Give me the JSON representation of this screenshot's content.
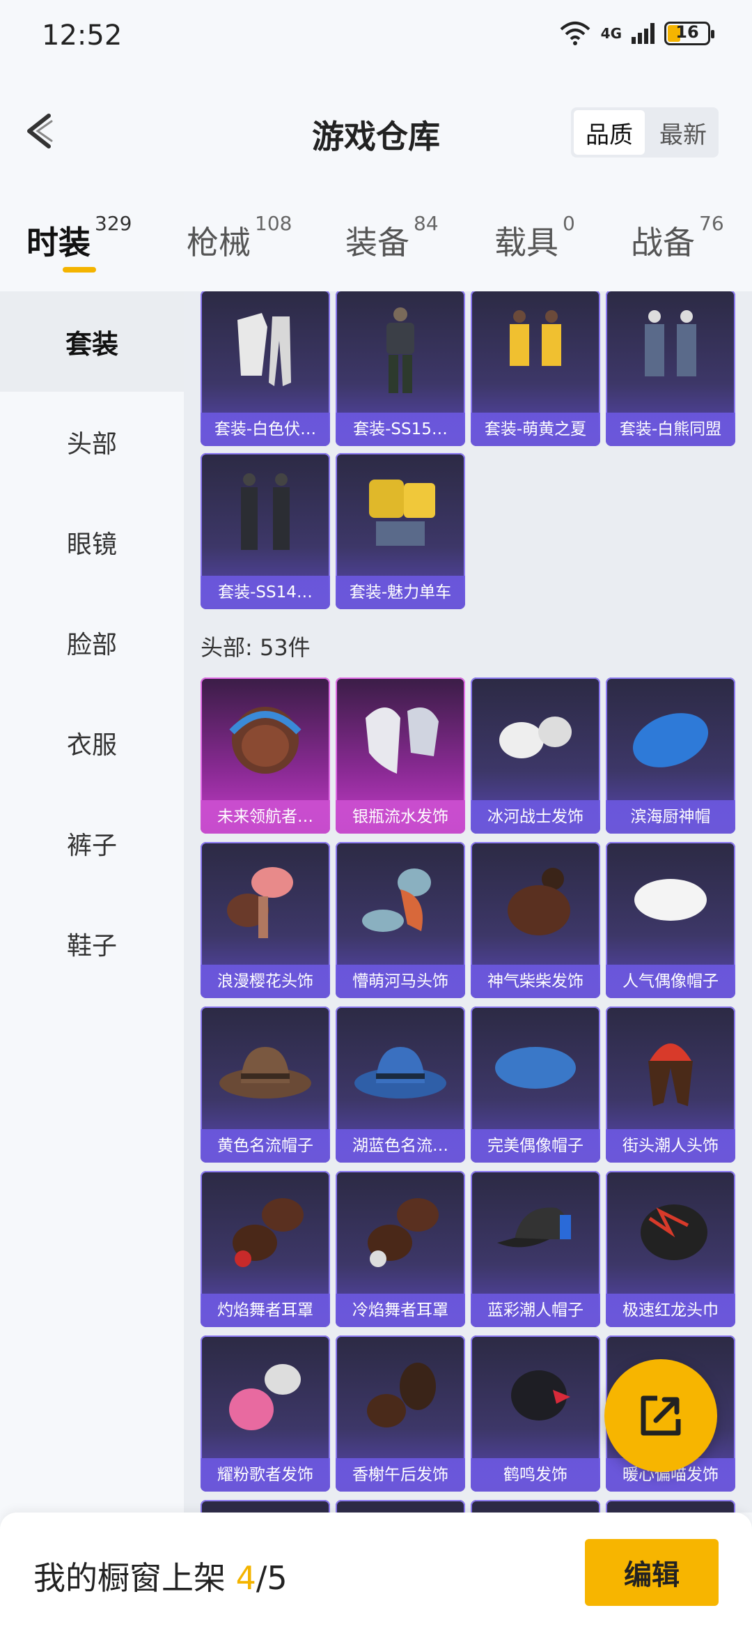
{
  "status_bar": {
    "time": "12:52",
    "network": "4G",
    "battery": "16"
  },
  "header": {
    "title": "游戏仓库",
    "sort_options": [
      "品质",
      "最新"
    ],
    "sort_selected": "品质"
  },
  "tabs": [
    {
      "label": "时装",
      "count": "329"
    },
    {
      "label": "枪械",
      "count": "108"
    },
    {
      "label": "装备",
      "count": "84"
    },
    {
      "label": "载具",
      "count": "0"
    },
    {
      "label": "战备",
      "count": "76"
    }
  ],
  "sidebar": {
    "items": [
      "套装",
      "头部",
      "眼镜",
      "脸部",
      "衣服",
      "裤子",
      "鞋子"
    ],
    "active": "套装"
  },
  "suits": [
    {
      "name": "套装-白色伏…"
    },
    {
      "name": "套装-SS15…"
    },
    {
      "name": "套装-萌黄之夏"
    },
    {
      "name": "套装-白熊同盟"
    },
    {
      "name": "套装-SS14…"
    },
    {
      "name": "套装-魅力单车"
    }
  ],
  "head_section": {
    "title": "头部: 53件"
  },
  "head_items": [
    {
      "name": "未来领航者…",
      "rarity": "legendary"
    },
    {
      "name": "银瓶流水发饰",
      "rarity": "legendary"
    },
    {
      "name": "冰河战士发饰",
      "rarity": "epic"
    },
    {
      "name": "滨海厨神帽",
      "rarity": "epic"
    },
    {
      "name": "浪漫樱花头饰",
      "rarity": "epic"
    },
    {
      "name": "懵萌河马头饰",
      "rarity": "epic"
    },
    {
      "name": "神气柴柴发饰",
      "rarity": "epic"
    },
    {
      "name": "人气偶像帽子",
      "rarity": "epic"
    },
    {
      "name": "黄色名流帽子",
      "rarity": "epic"
    },
    {
      "name": "湖蓝色名流…",
      "rarity": "epic"
    },
    {
      "name": "完美偶像帽子",
      "rarity": "epic"
    },
    {
      "name": "街头潮人头饰",
      "rarity": "epic"
    },
    {
      "name": "灼焰舞者耳罩",
      "rarity": "epic"
    },
    {
      "name": "冷焰舞者耳罩",
      "rarity": "epic"
    },
    {
      "name": "蓝彩潮人帽子",
      "rarity": "epic"
    },
    {
      "name": "极速红龙头巾",
      "rarity": "epic"
    },
    {
      "name": "耀粉歌者发饰",
      "rarity": "epic"
    },
    {
      "name": "香榭午后发饰",
      "rarity": "epic"
    },
    {
      "name": "鹤鸣发饰",
      "rarity": "epic"
    },
    {
      "name": "暖心偏喵发饰",
      "rarity": "epic"
    }
  ],
  "bottom_bar": {
    "label": "我的橱窗上架",
    "current": "4",
    "total": "/5",
    "edit_button": "编辑"
  },
  "colors": {
    "accent": "#f7b500",
    "epic": "#6b57d8",
    "legendary": "#c64ccc"
  }
}
